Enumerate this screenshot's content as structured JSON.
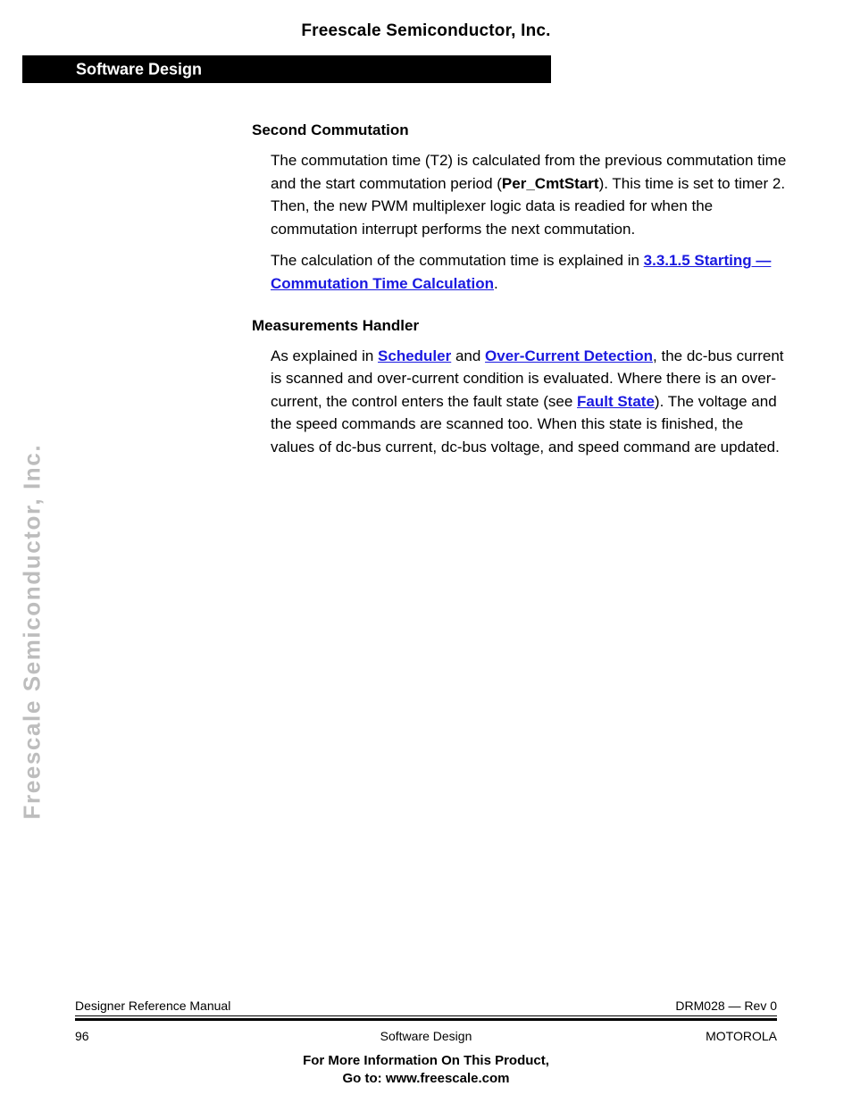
{
  "page": {
    "running_head": "Freescale Semiconductor, Inc.",
    "side_watermark": "Freescale Semiconductor, Inc.",
    "link_color": "#1a19e0",
    "banner_color": "#000000"
  },
  "banner": {
    "label": "Software Design"
  },
  "content": {
    "section1": {
      "heading": "Second Commutation",
      "para1": {
        "t1": "The commutation time (T2) is calculated from the previous commutation time and the start commutation period (",
        "bold1": "Per_CmtStart",
        "t2": "). This time is set to timer 2. Then, the new PWM multiplexer logic data is readied for when the commutation interrupt performs the next commutation."
      },
      "para2": {
        "t1": "The calculation of the commutation time is explained in ",
        "link1": "3.3.1.5 Starting — Commutation Time Calculation",
        "t2": "."
      }
    },
    "section2": {
      "heading": "Measurements Handler",
      "para1": {
        "t1": "As explained in ",
        "link1": "Scheduler",
        "t2": " and ",
        "link2": "Over-Current Detection",
        "t3": ", the dc-bus current is scanned and over-current condition is evaluated. Where there is an over-current, the control enters the fault state (see ",
        "link3": "Fault State",
        "t4": "). The voltage and the speed commands are scanned too. When this state is finished, the values of dc-bus current, dc-bus voltage, and speed command are updated."
      }
    }
  },
  "footer": {
    "manual_title": "Designer Reference Manual",
    "doc_rev": "DRM028 — Rev 0",
    "page_number": "96",
    "chapter_name": "Software Design",
    "company": "MOTOROLA",
    "promo_line1": "For More Information On This Product,",
    "promo_line2": "Go to: www.freescale.com"
  }
}
